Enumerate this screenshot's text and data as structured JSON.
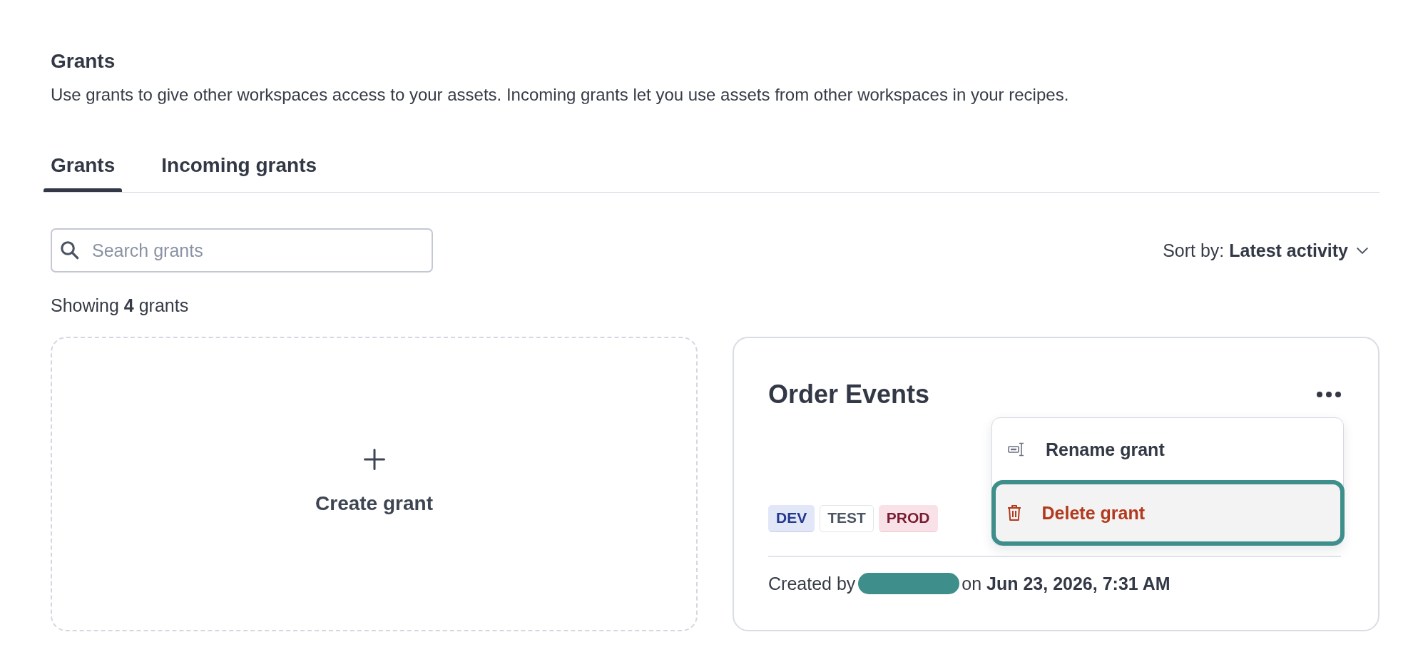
{
  "page": {
    "title": "Grants",
    "description": "Use grants to give other workspaces access to your assets. Incoming grants let you use assets from other workspaces in your recipes."
  },
  "tabs": [
    {
      "label": "Grants",
      "selected": true
    },
    {
      "label": "Incoming grants",
      "selected": false
    }
  ],
  "search": {
    "placeholder": "Search grants"
  },
  "sort": {
    "label": "Sort by: **Latest activity**"
  },
  "result_count": "Showing **4** grants",
  "create_card": {
    "label": "Create grant"
  },
  "grant_cards": [
    {
      "title": "Order Events",
      "tags": [
        {
          "label": "DEV",
          "kind": "filled",
          "color": "#22398f"
        },
        {
          "label": "TEST",
          "kind": "outlined",
          "color": "#4b5563"
        },
        {
          "label": "PROD",
          "kind": "filled",
          "color": "#7a1c34"
        }
      ],
      "created_by_label": "Created by",
      "created_on": "on **Jun 23, 2026, 7:31 AM**",
      "menu": {
        "expanded": true,
        "items": [
          {
            "label": "Rename grant",
            "kind": "normal",
            "highlighted": false
          },
          {
            "label": "Delete grant",
            "kind": "danger",
            "highlighted": true
          }
        ]
      }
    }
  ]
}
